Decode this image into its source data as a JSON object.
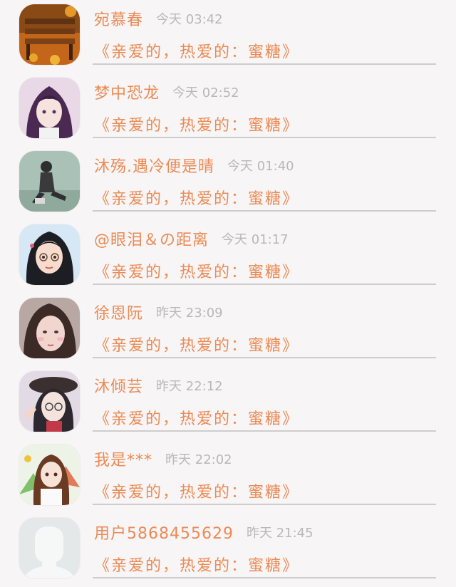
{
  "messages": [
    {
      "name": "宛慕春",
      "time": "今天 03:42",
      "preview": "《亲爱的，热爱的：蜜糖》",
      "avatar": "bench-autumn-photo"
    },
    {
      "name": "梦中恐龙",
      "time": "今天 02:52",
      "preview": "《亲爱的，热爱的：蜜糖》",
      "avatar": "anime-purple-hair"
    },
    {
      "name": "沐殇.遇冷便是晴",
      "time": "今天 01:40",
      "preview": "《亲爱的，热爱的：蜜糖》",
      "avatar": "sitting-figure-photo"
    },
    {
      "name": "@眼泪＆の距离",
      "time": "今天 01:17",
      "preview": "《亲爱的，热爱的：蜜糖》",
      "avatar": "cartoon-girl-glasses"
    },
    {
      "name": "徐恩阮",
      "time": "昨天 23:09",
      "preview": "《亲爱的，热爱的：蜜糖》",
      "avatar": "selfie-girl"
    },
    {
      "name": "沐倾芸",
      "time": "昨天 22:12",
      "preview": "《亲爱的，热爱的：蜜糖》",
      "avatar": "anime-girl-hat"
    },
    {
      "name": "我是***",
      "time": "昨天 22:02",
      "preview": "《亲爱的，热爱的：蜜糖》",
      "avatar": "anime-girl-colorful"
    },
    {
      "name": "用户5868455629",
      "time": "昨天 21:45",
      "preview": "《亲爱的，热爱的：蜜糖》",
      "avatar": "default-avatar-placeholder"
    }
  ]
}
